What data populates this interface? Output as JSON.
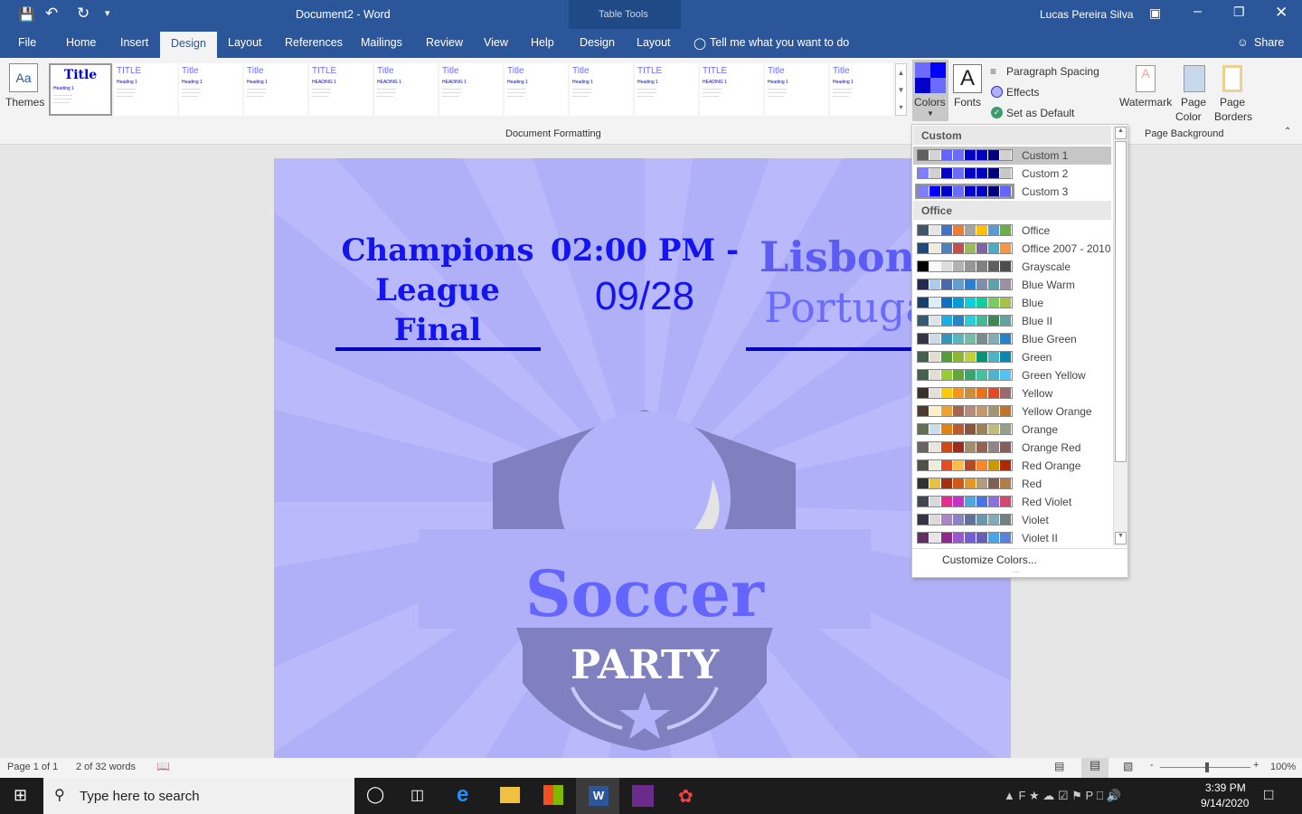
{
  "title": {
    "document": "Document2  -  Word",
    "table_tools": "Table Tools",
    "user": "Lucas Pereira Silva"
  },
  "tabs": [
    "File",
    "Home",
    "Insert",
    "Design",
    "Layout",
    "References",
    "Mailings",
    "Review",
    "View",
    "Help",
    "Design",
    "Layout"
  ],
  "tell_me": "Tell me what you want to do",
  "share": "Share",
  "ribbon": {
    "themes": "Themes",
    "gallery": [
      {
        "t": "Title",
        "h": "Heading 1"
      },
      {
        "t": "TITLE",
        "h": "Heading 1"
      },
      {
        "t": "Title",
        "h": "Heading 1"
      },
      {
        "t": "Title",
        "h": "Heading 1"
      },
      {
        "t": "TITLE",
        "h": "HEADING 1"
      },
      {
        "t": "Title",
        "h": "HEADING 1"
      },
      {
        "t": "Title",
        "h": "HEADING 1"
      },
      {
        "t": "Title",
        "h": "Heading 1"
      },
      {
        "t": "Title",
        "h": "Heading 1"
      },
      {
        "t": "TITLE",
        "h": "Heading 1"
      },
      {
        "t": "TITLE",
        "h": "HEADING 1"
      },
      {
        "t": "Title",
        "h": "Heading 1"
      },
      {
        "t": "Title",
        "h": "Heading 1"
      }
    ],
    "group_label": "Document Formatting",
    "colors": "Colors",
    "fonts": "Fonts",
    "paragraph_spacing": "Paragraph Spacing",
    "effects": "Effects",
    "set_default": "Set as Default",
    "watermark": "Watermark",
    "page_color_1": "Page",
    "page_color_2": "Color",
    "page_borders_1": "Page",
    "page_borders_2": "Borders",
    "page_background": "Page Background"
  },
  "document": {
    "event": [
      "Champions",
      "League",
      "Final"
    ],
    "time": "02:00 PM -",
    "date": "09/28",
    "city": "Lisbon",
    "country": "Portugal",
    "soccer": "Soccer",
    "party": "PARTY"
  },
  "colors_menu": {
    "custom_header": "Custom",
    "office_header": "Office",
    "customize": "Customize Colors...",
    "selected": "Custom 1",
    "custom": [
      {
        "name": "Custom 1",
        "c": [
          "#5f5f5f",
          "#d4d4d4",
          "#6464ff",
          "#6b6bff",
          "#0000c8",
          "#0000c0",
          "#000080",
          "#d0d0d0"
        ]
      },
      {
        "name": "Custom 2",
        "c": [
          "#8080ff",
          "#d0d0d0",
          "#0000c8",
          "#6b6bff",
          "#0000c8",
          "#0000c0",
          "#000080",
          "#c8c8c8"
        ]
      },
      {
        "name": "Custom 3",
        "c": [
          "#8080ff",
          "#0000ff",
          "#0000c8",
          "#6b6bff",
          "#0000c8",
          "#0000c0",
          "#000080",
          "#6464ff"
        ]
      }
    ],
    "office": [
      {
        "name": "Office",
        "c": [
          "#44546a",
          "#e7e6e6",
          "#4472c4",
          "#ed7d31",
          "#a5a5a5",
          "#ffc000",
          "#5b9bd5",
          "#70ad47"
        ]
      },
      {
        "name": "Office 2007 - 2010",
        "c": [
          "#1f497d",
          "#eeece1",
          "#4f81bd",
          "#c0504d",
          "#9bbb59",
          "#8064a2",
          "#4bacc6",
          "#f79646"
        ]
      },
      {
        "name": "Grayscale",
        "c": [
          "#000000",
          "#f8f8f8",
          "#dddddd",
          "#b2b2b2",
          "#969696",
          "#808080",
          "#5f5f5f",
          "#4d4d4d"
        ]
      },
      {
        "name": "Blue Warm",
        "c": [
          "#242852",
          "#acccea",
          "#4a66ac",
          "#629dd1",
          "#297fd5",
          "#7f8fa9",
          "#5aa2ae",
          "#9d90a0"
        ]
      },
      {
        "name": "Blue",
        "c": [
          "#17406d",
          "#dbeff9",
          "#0f6fc6",
          "#009dd9",
          "#0bd0d9",
          "#10cf9b",
          "#7cca62",
          "#a5c249"
        ]
      },
      {
        "name": "Blue II",
        "c": [
          "#335b74",
          "#dfe3e5",
          "#1cade4",
          "#2683c6",
          "#27ced7",
          "#42ba97",
          "#3e8853",
          "#62a39f"
        ]
      },
      {
        "name": "Blue Green",
        "c": [
          "#373545",
          "#cedbe6",
          "#3494ba",
          "#58b6c0",
          "#75bda7",
          "#7a8c8e",
          "#84acb6",
          "#2683c6"
        ]
      },
      {
        "name": "Green",
        "c": [
          "#455f51",
          "#e3ded1",
          "#549e39",
          "#8ab833",
          "#c0cf3a",
          "#029676",
          "#4ab5c4",
          "#0989b1"
        ]
      },
      {
        "name": "Green Yellow",
        "c": [
          "#455f51",
          "#e3ded1",
          "#99cb38",
          "#63a537",
          "#37a76f",
          "#44c1a3",
          "#4eb3cf",
          "#51c3f9"
        ]
      },
      {
        "name": "Yellow",
        "c": [
          "#39302a",
          "#e5dedb",
          "#ffca08",
          "#f8931d",
          "#ce8d3e",
          "#ec7016",
          "#e64823",
          "#9c6a6a"
        ]
      },
      {
        "name": "Yellow Orange",
        "c": [
          "#4e3b30",
          "#fbeec9",
          "#f0a22e",
          "#a5644e",
          "#b58b80",
          "#c3986d",
          "#a19574",
          "#c17529"
        ]
      },
      {
        "name": "Orange",
        "c": [
          "#637052",
          "#ccddea",
          "#e48312",
          "#bd582c",
          "#865640",
          "#9b8357",
          "#c2bc80",
          "#94a088"
        ]
      },
      {
        "name": "Orange Red",
        "c": [
          "#696464",
          "#e9e5dc",
          "#d34817",
          "#9b2d1f",
          "#a28e6a",
          "#956251",
          "#918485",
          "#855d5d"
        ]
      },
      {
        "name": "Red Orange",
        "c": [
          "#505046",
          "#eeece1",
          "#e84c22",
          "#ffbd47",
          "#b64926",
          "#ff8427",
          "#cc9900",
          "#b22600"
        ]
      },
      {
        "name": "Red",
        "c": [
          "#323232",
          "#e5c243",
          "#a5300f",
          "#d55816",
          "#e19825",
          "#b19c7d",
          "#7f5f52",
          "#b27d49"
        ]
      },
      {
        "name": "Red Violet",
        "c": [
          "#454551",
          "#d8d9dc",
          "#e32d91",
          "#c830cc",
          "#4ea6dc",
          "#4775e7",
          "#8971e1",
          "#d54773"
        ]
      },
      {
        "name": "Violet",
        "c": [
          "#373545",
          "#dcd8dc",
          "#ad84c6",
          "#8784c7",
          "#5d739a",
          "#6997af",
          "#84acb6",
          "#6f8183"
        ]
      },
      {
        "name": "Violet II",
        "c": [
          "#632e62",
          "#eae5eb",
          "#92278f",
          "#9b57d3",
          "#755dd9",
          "#665eb8",
          "#45a5ed",
          "#5982db"
        ]
      }
    ]
  },
  "status": {
    "page": "Page 1 of 1",
    "words": "2 of 32 words",
    "zoom": "100%",
    "zoom_percent": 100
  },
  "taskbar": {
    "search": "Type here to search",
    "time": "3:39 PM",
    "date": "9/14/2020"
  }
}
